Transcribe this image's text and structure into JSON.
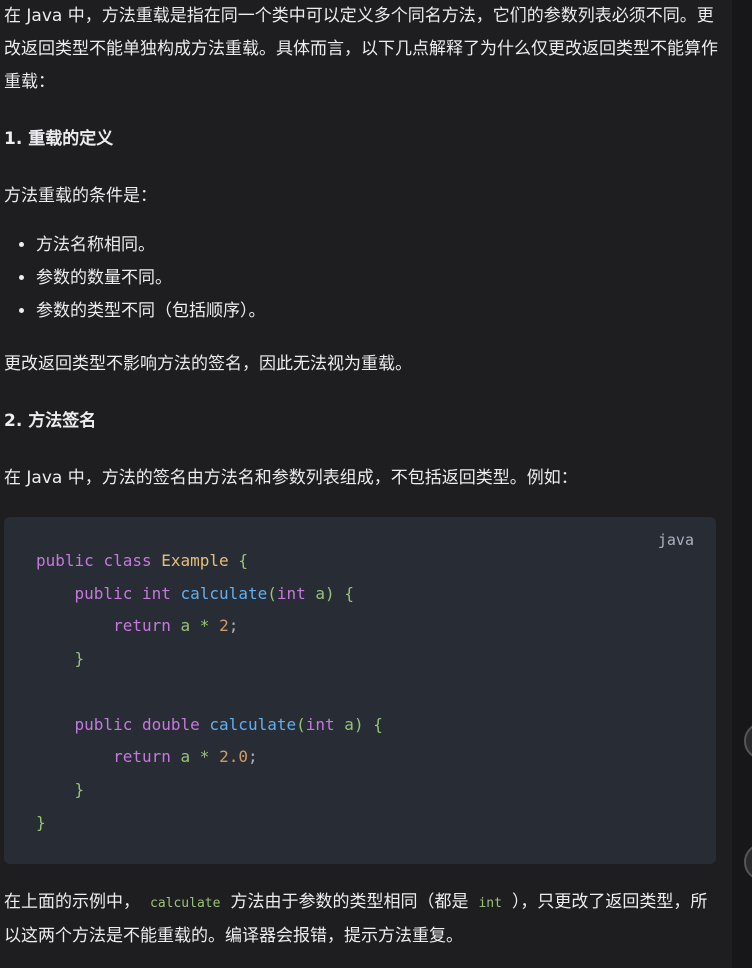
{
  "intro": "在 Java 中，方法重载是指在同一个类中可以定义多个同名方法，它们的参数列表必须不同。更改返回类型不能单独构成方法重载。具体而言，以下几点解释了为什么仅更改返回类型不能算作重载：",
  "section1": {
    "heading": "1. 重载的定义",
    "lead": "方法重载的条件是：",
    "bullets": [
      "方法名称相同。",
      "参数的数量不同。",
      "参数的类型不同（包括顺序）。"
    ],
    "conclusion": "更改返回类型不影响方法的签名，因此无法视为重载。"
  },
  "section2": {
    "heading": "2. 方法签名",
    "lead": "在 Java 中，方法的签名由方法名和参数列表组成，不包括返回类型。例如："
  },
  "code": {
    "language": "java"
  },
  "final": {
    "part1": "在上面的示例中，",
    "code1": "calculate",
    "part2": "方法由于参数的类型相同（都是",
    "code2": "int",
    "part3": "），只更改了返回类型，所以这两个方法是不能重载的。编译器会报错，提示方法重复。"
  }
}
